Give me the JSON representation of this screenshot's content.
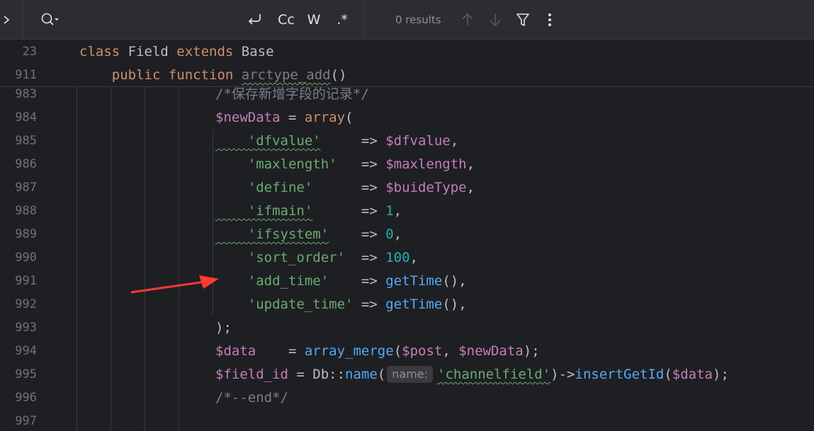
{
  "search": {
    "expand_icon": "chevron-right-icon",
    "search_icon": "search-history-icon",
    "results_text": "0 results",
    "tools": {
      "wrap_icon": "new-line-icon",
      "match_case_label": "Cc",
      "words_label": "W",
      "regex_label": ".*"
    },
    "prev_icon": "arrow-up-icon",
    "next_icon": "arrow-down-icon",
    "filter_icon": "filter-icon",
    "more_icon": "more-vertical-icon"
  },
  "sticky": [
    {
      "ln": "23",
      "parts": [
        [
          "kw",
          "class"
        ],
        [
          "plain",
          " Field "
        ],
        [
          "kw",
          "extends"
        ],
        [
          "plain",
          " Base"
        ]
      ]
    },
    {
      "ln": "911",
      "parts": [
        [
          "kw",
          "    public function "
        ],
        [
          "fn-dim",
          "arctype_add"
        ],
        [
          "plain",
          "()"
        ]
      ]
    }
  ],
  "lines": [
    {
      "ln": "983",
      "parts": [
        [
          "cmt",
          "/*保存新增字段的记录*/"
        ]
      ]
    },
    {
      "ln": "984",
      "parts": [
        [
          "var",
          "$newData"
        ],
        [
          "plain",
          " = "
        ],
        [
          "kw",
          "array"
        ],
        [
          "plain",
          "("
        ]
      ]
    },
    {
      "ln": "985",
      "parts": [
        [
          "str",
          "    'dfvalue'"
        ],
        [
          "plain",
          "     => "
        ],
        [
          "var",
          "$dfvalue"
        ],
        [
          "plain",
          ","
        ]
      ]
    },
    {
      "ln": "986",
      "parts": [
        [
          "str",
          "    'maxlength'"
        ],
        [
          "plain",
          "   => "
        ],
        [
          "var",
          "$maxlength"
        ],
        [
          "plain",
          ","
        ]
      ]
    },
    {
      "ln": "987",
      "parts": [
        [
          "str",
          "    'define'"
        ],
        [
          "plain",
          "      => "
        ],
        [
          "var",
          "$buideType"
        ],
        [
          "plain",
          ","
        ]
      ]
    },
    {
      "ln": "988",
      "parts": [
        [
          "str",
          "    'ifmain'"
        ],
        [
          "plain",
          "      => "
        ],
        [
          "num",
          "1"
        ],
        [
          "plain",
          ","
        ]
      ]
    },
    {
      "ln": "989",
      "parts": [
        [
          "str",
          "    'ifsystem'"
        ],
        [
          "plain",
          "    => "
        ],
        [
          "num",
          "0"
        ],
        [
          "plain",
          ","
        ]
      ]
    },
    {
      "ln": "990",
      "parts": [
        [
          "str",
          "    'sort_order'"
        ],
        [
          "plain",
          "  => "
        ],
        [
          "num",
          "100"
        ],
        [
          "plain",
          ","
        ]
      ]
    },
    {
      "ln": "991",
      "parts": [
        [
          "str",
          "    'add_time'"
        ],
        [
          "plain",
          "    => "
        ],
        [
          "fn",
          "getTime"
        ],
        [
          "plain",
          "(),"
        ]
      ]
    },
    {
      "ln": "992",
      "parts": [
        [
          "str",
          "    'update_time'"
        ],
        [
          "plain",
          " => "
        ],
        [
          "fn",
          "getTime"
        ],
        [
          "plain",
          "(),"
        ]
      ]
    },
    {
      "ln": "993",
      "parts": [
        [
          "plain",
          ");"
        ]
      ]
    },
    {
      "ln": "994",
      "parts": [
        [
          "var",
          "$data"
        ],
        [
          "plain",
          "    = "
        ],
        [
          "fn",
          "array_merge"
        ],
        [
          "plain",
          "("
        ],
        [
          "var",
          "$post"
        ],
        [
          "plain",
          ", "
        ],
        [
          "var",
          "$newData"
        ],
        [
          "plain",
          ");"
        ]
      ]
    },
    {
      "ln": "995",
      "parts": [
        [
          "var",
          "$field_id"
        ],
        [
          "plain",
          " = Db::"
        ],
        [
          "fn",
          "name"
        ],
        [
          "plain",
          "("
        ],
        [
          "hint",
          "name:"
        ],
        [
          "str",
          "'channelfield'"
        ],
        [
          "plain",
          ")->"
        ],
        [
          "fn",
          "insertGetId"
        ],
        [
          "plain",
          "("
        ],
        [
          "var",
          "$data"
        ],
        [
          "plain",
          ");"
        ]
      ]
    },
    {
      "ln": "996",
      "parts": [
        [
          "cmt",
          "/*--end*/"
        ]
      ]
    },
    {
      "ln": "997",
      "parts": []
    }
  ],
  "colors": {
    "background": "#1e1f22",
    "keyword": "#cf8e6d",
    "string": "#6aab73",
    "variable": "#c77dbb",
    "function": "#56a8f5",
    "number": "#2aacb8",
    "comment": "#7a7e85",
    "annotation_arrow": "#ff3b30"
  }
}
